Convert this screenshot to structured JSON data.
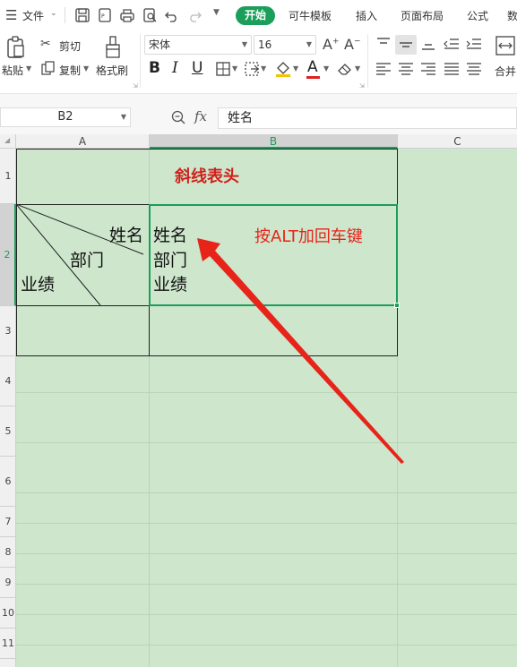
{
  "menubar": {
    "hamburger_icon": "menu-icon",
    "file_label": "文件",
    "tabs": [
      "开始",
      "可牛模板",
      "插入",
      "页面布局",
      "公式",
      "数"
    ]
  },
  "ribbon": {
    "paste_label": "粘贴",
    "cut_label": "剪切",
    "copy_label": "复制",
    "format_painter_label": "格式刷",
    "font_name": "宋体",
    "font_size": "16",
    "bold": "B",
    "italic": "I",
    "underline": "U",
    "font_color_glyph": "A",
    "merge_label": "合并"
  },
  "formula_bar": {
    "name_box": "B2",
    "fx_label": "fx",
    "content": "姓名"
  },
  "columns": [
    "A",
    "B",
    "C"
  ],
  "rows": [
    "1",
    "2",
    "3",
    "4",
    "5",
    "6",
    "7",
    "8",
    "9",
    "10",
    "11"
  ],
  "cells": {
    "title": "斜线表头",
    "a2_name": "姓名",
    "a2_dept": "部门",
    "a2_perf": "业绩",
    "b2_line1": "姓名",
    "b2_line2": "部门",
    "b2_line3": "业绩",
    "annotation": "按ALT加回车键"
  },
  "colors": {
    "accent": "#1a9e5a",
    "sheet_bg": "#cde6cc",
    "annotation_red": "#e8231a",
    "title_red": "#d0201b"
  }
}
